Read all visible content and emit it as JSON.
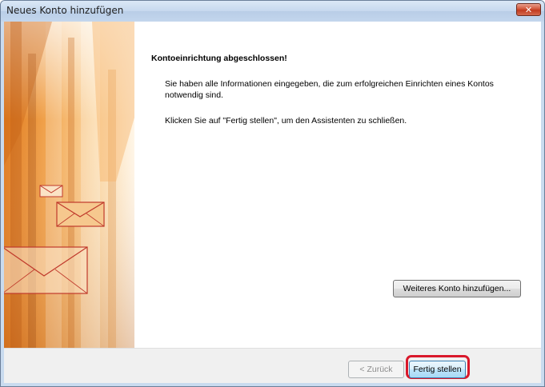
{
  "window": {
    "title": "Neues Konto hinzufügen",
    "close_glyph": "✕"
  },
  "main": {
    "heading": "Kontoeinrichtung abgeschlossen!",
    "paragraph1": "Sie haben alle Informationen eingegeben, die zum erfolgreichen Einrichten eines Kontos notwendig sind.",
    "paragraph2": "Klicken Sie auf \"Fertig stellen\", um den Assistenten zu schließen.",
    "add_another_label": "Weiteres Konto hinzufügen..."
  },
  "footer": {
    "back_label": "< Zurück",
    "finish_label": "Fertig stellen"
  },
  "colors": {
    "banner_orange": "#e8962f",
    "envelope_border": "#c0392b",
    "highlight": "#d9182b"
  }
}
